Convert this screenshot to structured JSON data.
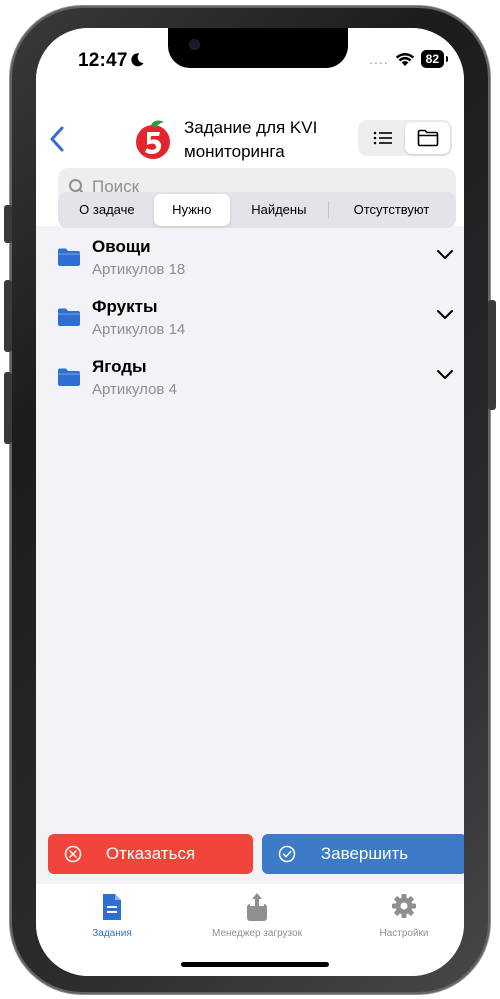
{
  "status_bar": {
    "time": "12:47",
    "signal_dots": "....",
    "battery": "82"
  },
  "header": {
    "title": "Задание для KVI мониторинга"
  },
  "search": {
    "placeholder": "Поиск"
  },
  "tabs": [
    {
      "label": "О задаче",
      "active": false
    },
    {
      "label": "Нужно",
      "active": true
    },
    {
      "label": "Найдены",
      "active": false
    },
    {
      "label": "Отсутствуют",
      "active": false
    }
  ],
  "groups": [
    {
      "name": "Овощи",
      "count": "Артикулов 18"
    },
    {
      "name": "Фрукты",
      "count": "Артикулов 14"
    },
    {
      "name": "Ягоды",
      "count": "Артикулов 4"
    }
  ],
  "actions": {
    "reject_label": "Отказаться",
    "finish_label": "Завершить"
  },
  "tabbar": [
    {
      "label": "Задания",
      "icon": "document-icon",
      "active": true
    },
    {
      "label": "Менеджер загрузок",
      "icon": "upload-icon",
      "active": false
    },
    {
      "label": "Настройки",
      "icon": "gear-icon",
      "active": false
    }
  ],
  "colors": {
    "accent": "#2f6fd3",
    "reject": "#f1453b",
    "finish": "#3d7ac7",
    "folder": "#2f6fd3"
  }
}
